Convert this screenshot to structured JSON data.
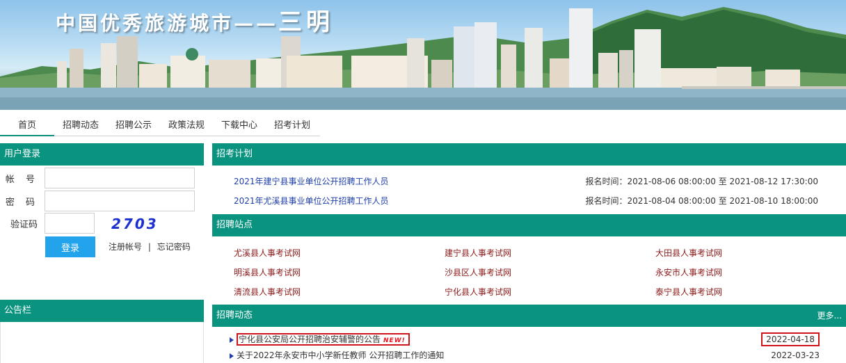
{
  "banner": {
    "title": "中国优秀旅游城市——",
    "city": "三明"
  },
  "nav": {
    "items": [
      {
        "label": "首页"
      },
      {
        "label": "招聘动态"
      },
      {
        "label": "招聘公示"
      },
      {
        "label": "政策法规"
      },
      {
        "label": "下载中心"
      },
      {
        "label": "招考计划"
      }
    ]
  },
  "login": {
    "header": "用户登录",
    "account_label": "帐 号",
    "password_label": "密 码",
    "captcha_label": "验证码",
    "account_value": "",
    "password_value": "",
    "captcha_value": "",
    "captcha_code": "2703",
    "submit_label": "登录",
    "register_label": "注册帐号",
    "separator": "|",
    "forgot_label": "忘记密码"
  },
  "notice": {
    "header": "公告栏"
  },
  "plan": {
    "header": "招考计划",
    "items": [
      {
        "title": "2021年建宁县事业单位公开招聘工作人员",
        "time": "报名时间：2021-08-06 08:00:00 至 2021-08-12 17:30:00"
      },
      {
        "title": "2021年尤溪县事业单位公开招聘工作人员",
        "time": "报名时间：2021-08-04 08:00:00 至 2021-08-10 18:00:00"
      }
    ]
  },
  "sites": {
    "header": "招聘站点",
    "items": [
      {
        "label": "尤溪县人事考试网"
      },
      {
        "label": "建宁县人事考试网"
      },
      {
        "label": "大田县人事考试网"
      },
      {
        "label": "明溪县人事考试网"
      },
      {
        "label": "沙县区人事考试网"
      },
      {
        "label": "永安市人事考试网"
      },
      {
        "label": "清流县人事考试网"
      },
      {
        "label": "宁化县人事考试网"
      },
      {
        "label": "泰宁县人事考试网"
      }
    ]
  },
  "news": {
    "header": "招聘动态",
    "more_label": "更多...",
    "new_badge": "NEW!",
    "items": [
      {
        "title": "宁化县公安局公开招聘治安辅警的公告",
        "date": "2022-04-18"
      },
      {
        "title": "关于2022年永安市中小学新任教师 公开招聘工作的通知",
        "date": "2022-03-23"
      }
    ]
  },
  "colors": {
    "accent": "#0a9480",
    "link_blue": "#1f3fa8",
    "site_red": "#8b1a1a",
    "button_blue": "#22a3ec",
    "highlight_red": "#d0121b"
  }
}
